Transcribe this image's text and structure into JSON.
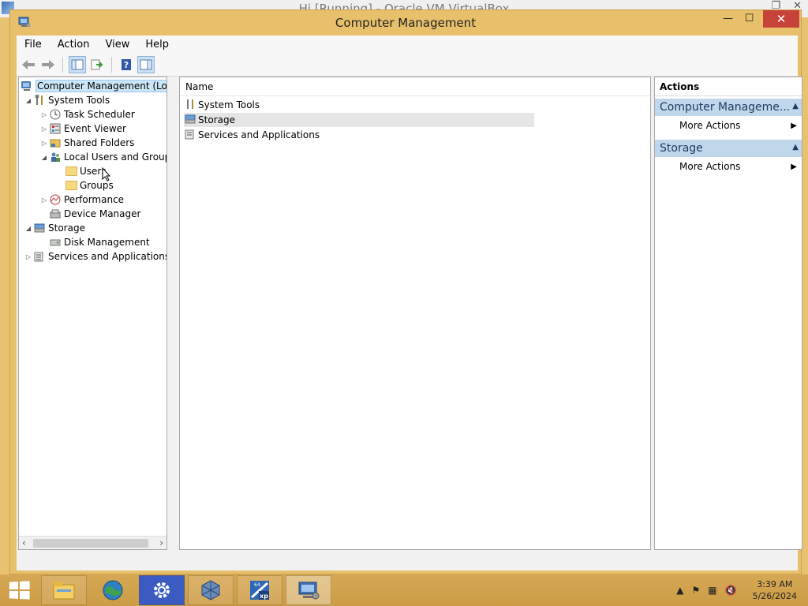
{
  "vbox": {
    "title": "Hi [Running] - Oracle VM VirtualBox"
  },
  "window": {
    "title": "Computer Management",
    "minimize_glyph": "—",
    "maximize_glyph": "☐",
    "close_glyph": "✕"
  },
  "menu": [
    "File",
    "Action",
    "View",
    "Help"
  ],
  "toolbar": {
    "icons": [
      "back-arrow-icon",
      "forward-arrow-icon",
      "show-hide-tree-icon",
      "export-list-icon",
      "help-icon",
      "show-hide-action-pane-icon"
    ]
  },
  "tree": {
    "root": "Computer Management (Local",
    "system_tools": "System Tools",
    "task_scheduler": "Task Scheduler",
    "event_viewer": "Event Viewer",
    "shared_folders": "Shared Folders",
    "local_users": "Local Users and Groups",
    "users": "Users",
    "groups": "Groups",
    "performance": "Performance",
    "device_manager": "Device Manager",
    "storage": "Storage",
    "disk_management": "Disk Management",
    "services": "Services and Applications"
  },
  "list": {
    "column_name": "Name",
    "items": [
      "System Tools",
      "Storage",
      "Services and Applications"
    ]
  },
  "actions": {
    "header": "Actions",
    "groups": [
      {
        "title": "Computer Manageme...",
        "item": "More Actions"
      },
      {
        "title": "Storage",
        "item": "More Actions"
      }
    ]
  },
  "taskbar": {
    "apps": [
      "file-explorer-icon",
      "browser-globe-icon",
      "settings-gear-icon",
      "virtualbox-icon",
      "xp-mode-icon",
      "computer-management-icon"
    ],
    "time": "3:39 AM",
    "date": "5/26/2024"
  },
  "colors": {
    "frame": "#e8c06c",
    "action_group_bg": "#c0d6ea",
    "close_button": "#c7433a",
    "selection": "#cde6f7"
  }
}
